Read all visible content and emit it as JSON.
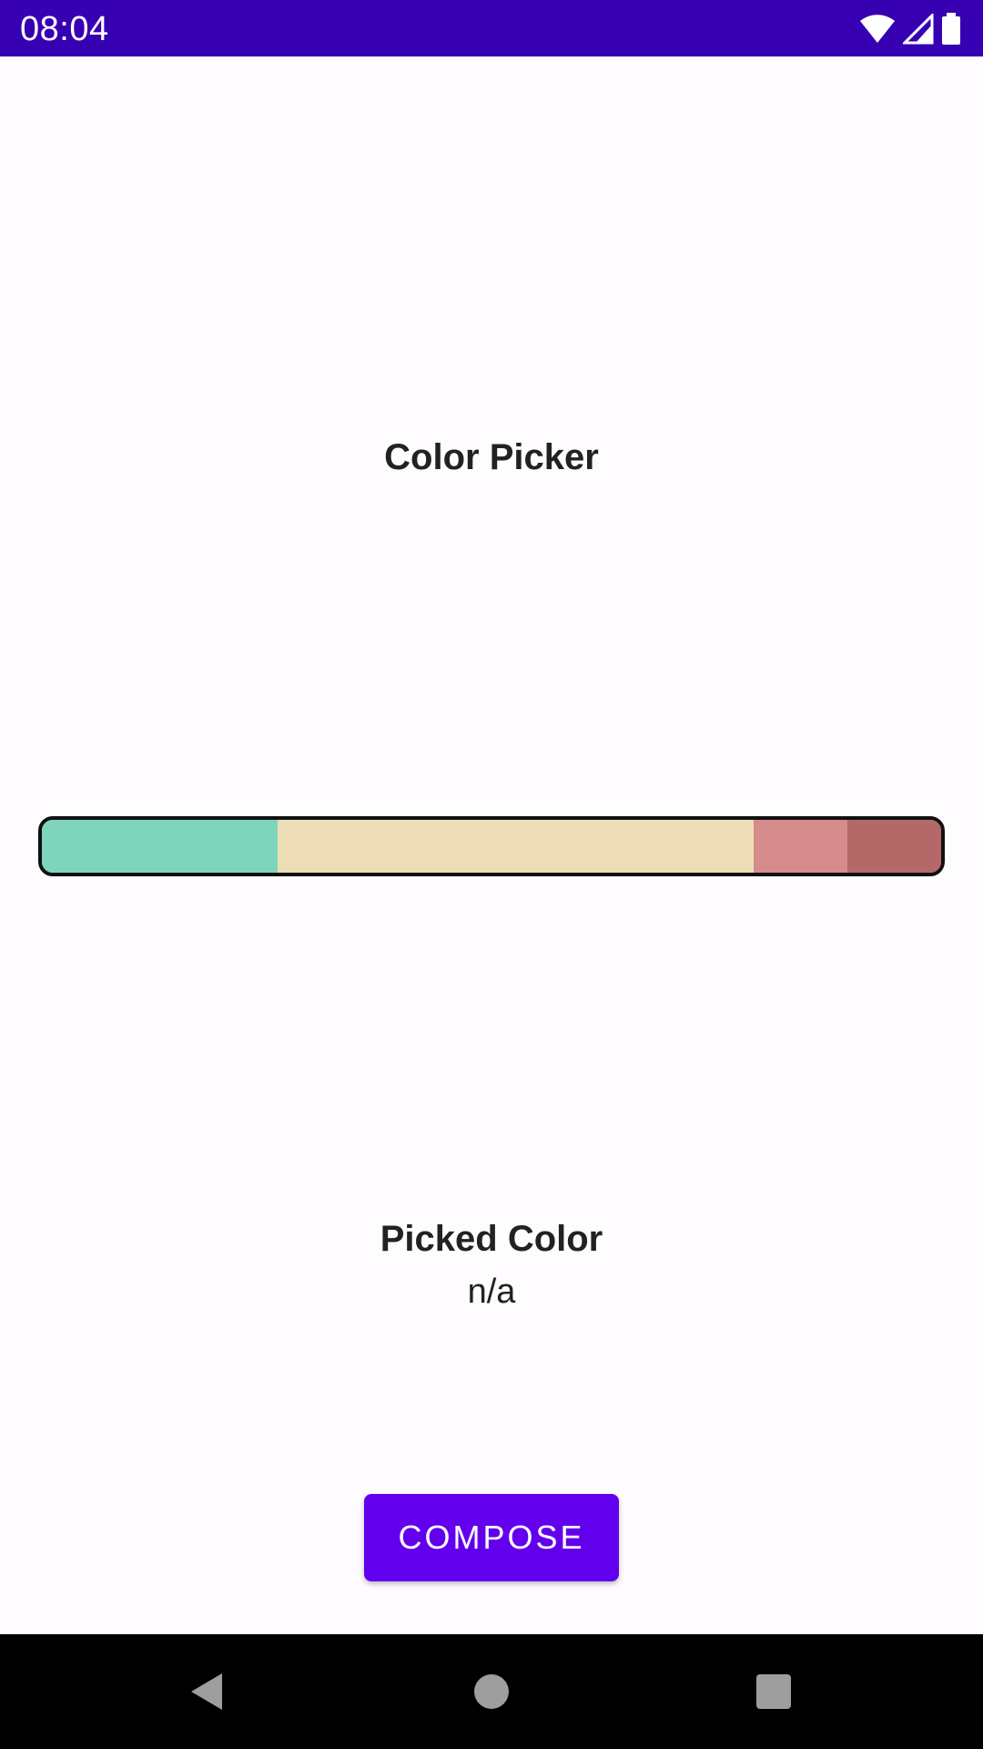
{
  "status_bar": {
    "time": "08:04",
    "background": "#3700B3",
    "icons": [
      "wifi-icon",
      "cellular-signal-icon",
      "battery-icon"
    ]
  },
  "title": "Color Picker",
  "color_bar": {
    "swatches": [
      {
        "color": "#7FD5BC",
        "fraction": 0.262
      },
      {
        "color": "#ECDDB6",
        "fraction": 0.53
      },
      {
        "color": "#D68B8C",
        "fraction": 0.104
      },
      {
        "color": "#B46868",
        "fraction": 0.104
      }
    ]
  },
  "picked": {
    "label": "Picked Color",
    "value": "n/a"
  },
  "compose_button": {
    "label": "COMPOSE",
    "color": "#6200EE"
  },
  "nav_bar": {
    "icons": [
      "back-icon",
      "home-icon",
      "recents-icon"
    ]
  }
}
